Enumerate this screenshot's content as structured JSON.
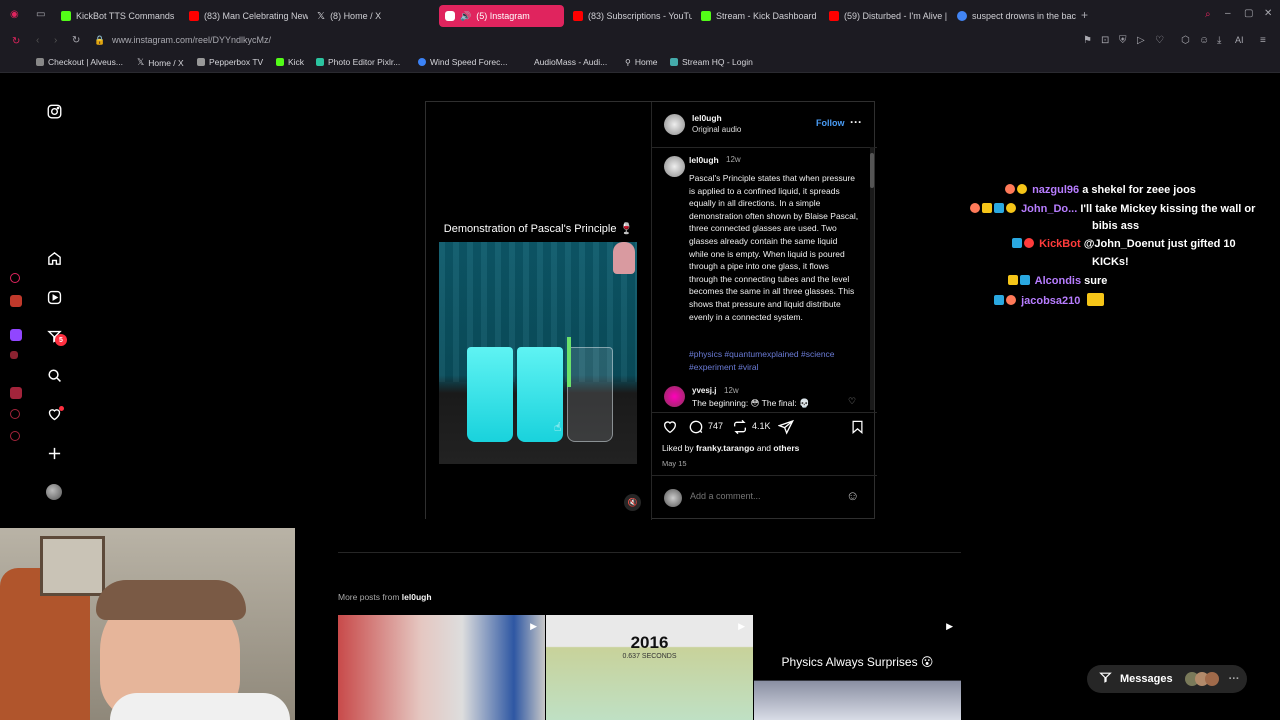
{
  "browser": {
    "tabs": [
      {
        "label": "KickBot TTS Commands",
        "color": "#53fc18"
      },
      {
        "label": "(83) Man Celebrating New",
        "color": "#ff0000"
      },
      {
        "label": "(8) Home / X",
        "color": "#ffffff"
      },
      {
        "label": "(5) Instagram",
        "color": "#e1306c"
      },
      {
        "label": "(83) Subscriptions - YouTu",
        "color": "#ff0000"
      },
      {
        "label": "Stream - Kick Dashboard",
        "color": "#53fc18"
      },
      {
        "label": "(59) Disturbed - I'm Alive |",
        "color": "#ff0000"
      },
      {
        "label": "suspect drowns in the back",
        "color": "#4285f4"
      }
    ],
    "url": "www.instagram.com/reel/DYYndlkycMz/",
    "bookmarks": [
      {
        "label": "Checkout | Alveus..."
      },
      {
        "label": "Home / X"
      },
      {
        "label": "Pepperbox TV"
      },
      {
        "label": "Kick"
      },
      {
        "label": "Photo Editor Pixlr..."
      },
      {
        "label": "Wind Speed Forec..."
      },
      {
        "label": "AudioMass - Audi..."
      },
      {
        "label": "Home"
      },
      {
        "label": "Stream HQ - Login"
      }
    ]
  },
  "nav": {
    "notifications_badge": "5"
  },
  "post": {
    "username": "lel0ugh",
    "audio": "Original audio",
    "follow_label": "Follow",
    "more_glyph": "···",
    "video_title": "Demonstration of Pascal's Principle 🍷",
    "caption_user": "lel0ugh",
    "caption_age": "12w",
    "caption": "Pascal's Principle states that when pressure is applied to a confined liquid, it spreads equally in all directions. In a simple demonstration often shown by Blaise Pascal, three connected glasses are used. Two glasses already contain the same liquid while one is empty. When liquid is poured through a pipe into one glass, it flows through the connecting tubes and the level becomes the same in all three glasses. This shows that pressure and liquid distribute evenly in a connected system.",
    "tags": "#physics #quantumexplained #science #experiment #viral",
    "comment_user": "yvesj.j",
    "comment_age": "12w",
    "comment_text": "The beginning: 😳 The final: 💀",
    "comment_count": "747",
    "repost_count": "4.1K",
    "liked_by_prefix": "Liked by",
    "liked_by_user": "franky.tarango",
    "liked_by_suffix": "and",
    "liked_by_others": "others",
    "date": "May 15",
    "add_comment_placeholder": "Add a comment..."
  },
  "more_posts": {
    "heading_prefix": "More posts from",
    "heading_user": "lel0ugh",
    "thumb2_text": "2016",
    "thumb2_sub": "0.637 SECONDS",
    "thumb3_text": "Physics Always Surprises 😮"
  },
  "messages_label": "Messages",
  "chat": [
    {
      "user": "nazgul96",
      "color": "#b77dff",
      "text": "a shekel for zeee joos"
    },
    {
      "user": "John_Do...",
      "color": "#b77dff",
      "text": "I'll take Mickey kissing the wall or"
    },
    {
      "user": "",
      "color": "#ffffff",
      "text": "bibis ass"
    },
    {
      "user": "KickBot",
      "color": "#ff3b3b",
      "text": "@John_Doenut just gifted 10"
    },
    {
      "user": "",
      "color": "#ffffff",
      "text": "KICKs!"
    },
    {
      "user": "Alcondis",
      "color": "#b77dff",
      "text": "sure"
    },
    {
      "user": "jacobsa210",
      "color": "#b77dff",
      "text": ""
    }
  ]
}
